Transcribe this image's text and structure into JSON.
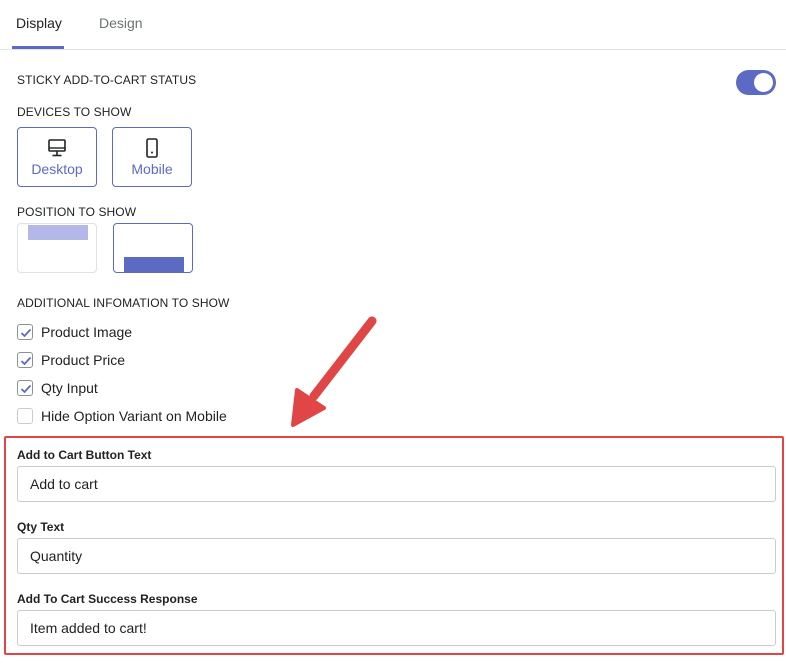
{
  "tabs": [
    {
      "label": "Display",
      "active": true
    },
    {
      "label": "Design",
      "active": false
    }
  ],
  "status": {
    "label": "STICKY ADD-TO-CART STATUS",
    "enabled": true
  },
  "devices": {
    "label": "DEVICES TO SHOW",
    "options": [
      {
        "label": "Desktop",
        "icon": "desktop-icon",
        "selected": true
      },
      {
        "label": "Mobile",
        "icon": "mobile-icon",
        "selected": true
      }
    ]
  },
  "position": {
    "label": "POSITION TO SHOW",
    "options": [
      {
        "name": "top",
        "selected": false
      },
      {
        "name": "bottom",
        "selected": true
      }
    ]
  },
  "additional": {
    "label": "ADDITIONAL INFOMATION TO SHOW",
    "items": [
      {
        "label": "Product Image",
        "checked": true
      },
      {
        "label": "Product Price",
        "checked": true
      },
      {
        "label": "Qty Input",
        "checked": true
      },
      {
        "label": "Hide Option Variant on Mobile",
        "checked": false
      }
    ]
  },
  "fields": [
    {
      "label": "Add to Cart Button Text",
      "value": "Add to cart"
    },
    {
      "label": "Qty Text",
      "value": "Quantity"
    },
    {
      "label": "Add To Cart Success Response",
      "value": "Item added to cart!"
    }
  ],
  "colors": {
    "accent": "#5c6ac4",
    "annotation": "#e04646"
  }
}
